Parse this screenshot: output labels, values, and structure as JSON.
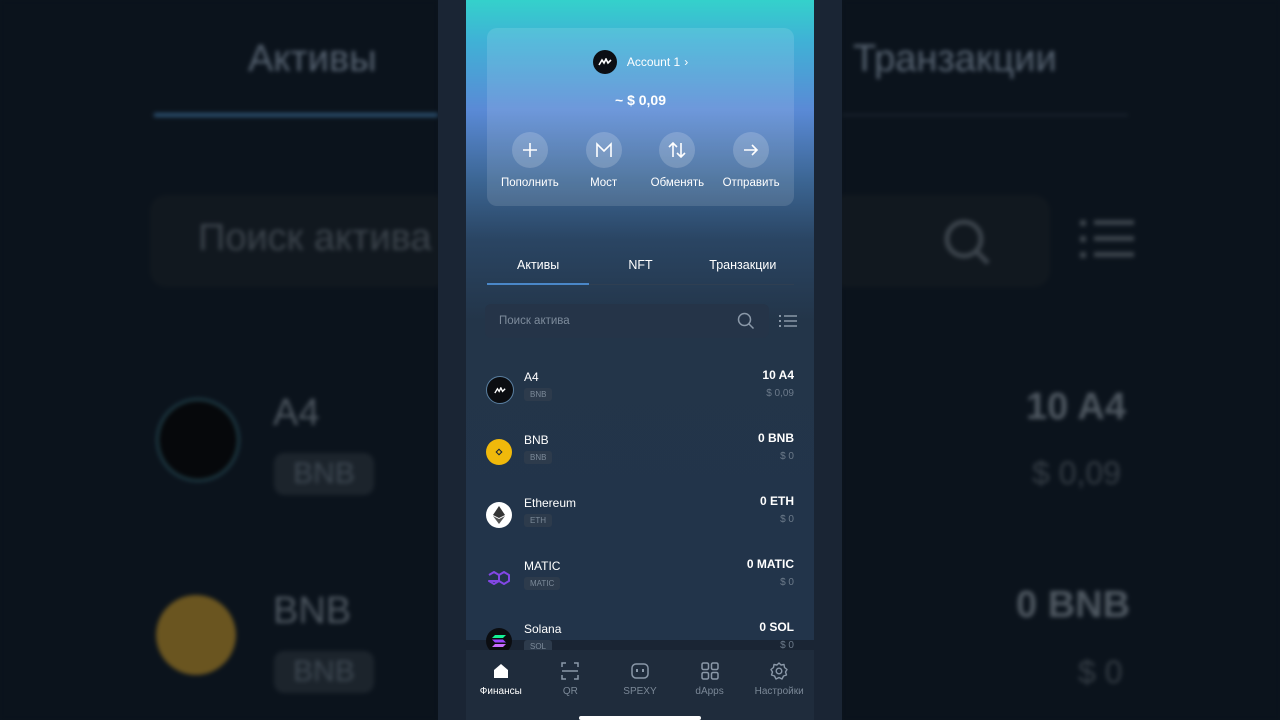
{
  "account": {
    "name": "Account 1",
    "chevron": "›",
    "balance": "~ $ 0,09"
  },
  "actions": [
    {
      "label": "Пополнить",
      "icon": "plus-icon"
    },
    {
      "label": "Мост",
      "icon": "bridge-icon"
    },
    {
      "label": "Обменять",
      "icon": "swap-icon"
    },
    {
      "label": "Отправить",
      "icon": "send-arrow-icon"
    }
  ],
  "tabs": [
    {
      "label": "Активы",
      "active": true
    },
    {
      "label": "NFT",
      "active": false
    },
    {
      "label": "Транзакции",
      "active": false
    }
  ],
  "search": {
    "placeholder": "Поиск актива"
  },
  "assets": [
    {
      "name": "A4",
      "network": "BNB",
      "amount": "10 A4",
      "usd": "$ 0,09"
    },
    {
      "name": "BNB",
      "network": "BNB",
      "amount": "0 BNB",
      "usd": "$ 0"
    },
    {
      "name": "Ethereum",
      "network": "ETH",
      "amount": "0 ETH",
      "usd": "$ 0"
    },
    {
      "name": "MATIC",
      "network": "MATIC",
      "amount": "0 MATIC",
      "usd": "$ 0"
    },
    {
      "name": "Solana",
      "network": "SOL",
      "amount": "0 SOL",
      "usd": "$ 0"
    }
  ],
  "nav": [
    {
      "label": "Финансы",
      "icon": "home-icon",
      "active": true
    },
    {
      "label": "QR",
      "icon": "qr-scan-icon",
      "active": false
    },
    {
      "label": "SPEXY",
      "icon": "spexy-icon",
      "active": false
    },
    {
      "label": "dApps",
      "icon": "apps-grid-icon",
      "active": false
    },
    {
      "label": "Настройки",
      "icon": "gear-icon",
      "active": false
    }
  ],
  "background": {
    "tab_assets": "Активы",
    "tab_transactions": "Транзакции",
    "search_placeholder": "Поиск актива",
    "a4_name": "A4",
    "a4_network": "BNB",
    "a4_amount": "10 A4",
    "a4_usd": "$ 0,09",
    "bnb_name": "BNB",
    "bnb_network": "BNB",
    "bnb_amount": "0 BNB",
    "bnb_usd": "$ 0"
  },
  "colors": {
    "accent": "#4a87c8",
    "bnb": "#f0b90b",
    "matic": "#8247e5",
    "panel": "#1a2534"
  }
}
